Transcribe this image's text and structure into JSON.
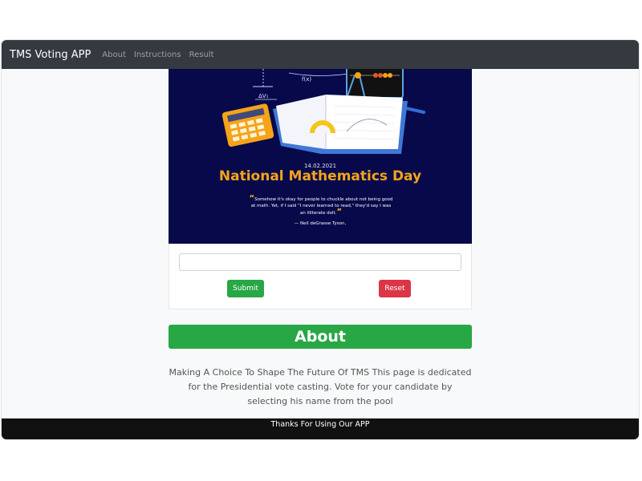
{
  "navbar": {
    "brand": "TMS Voting APP",
    "links": [
      "About",
      "Instructions",
      "Result"
    ]
  },
  "poster": {
    "date": "14.02.2021",
    "title": "National Mathematics Day",
    "quote": "Somehow it's okay for people to chuckle about not being good at math. Yet, if I said \"I never learned to read,\" they'd say I was an illiterate dolt.",
    "author": "— Neil deGrasse Tyson,",
    "formula_text": "f(x)",
    "formula_text2": "ΔV₁",
    "colors": {
      "background": "#07094a",
      "title": "#f5a31a",
      "quote_marks": "#f5c518"
    }
  },
  "form": {
    "input_value": "",
    "submit_label": "Submit",
    "reset_label": "Reset"
  },
  "about": {
    "heading": "About",
    "text": "Making A Choice To Shape The Future Of TMS This page is dedicated for the Presidential vote casting. Vote for your candidate by selecting his name from the pool"
  },
  "footer": {
    "text": "Thanks For Using Our APP"
  },
  "colors": {
    "navbar": "#343a40",
    "success": "#28a745",
    "danger": "#dc3545",
    "footer": "#111111"
  }
}
